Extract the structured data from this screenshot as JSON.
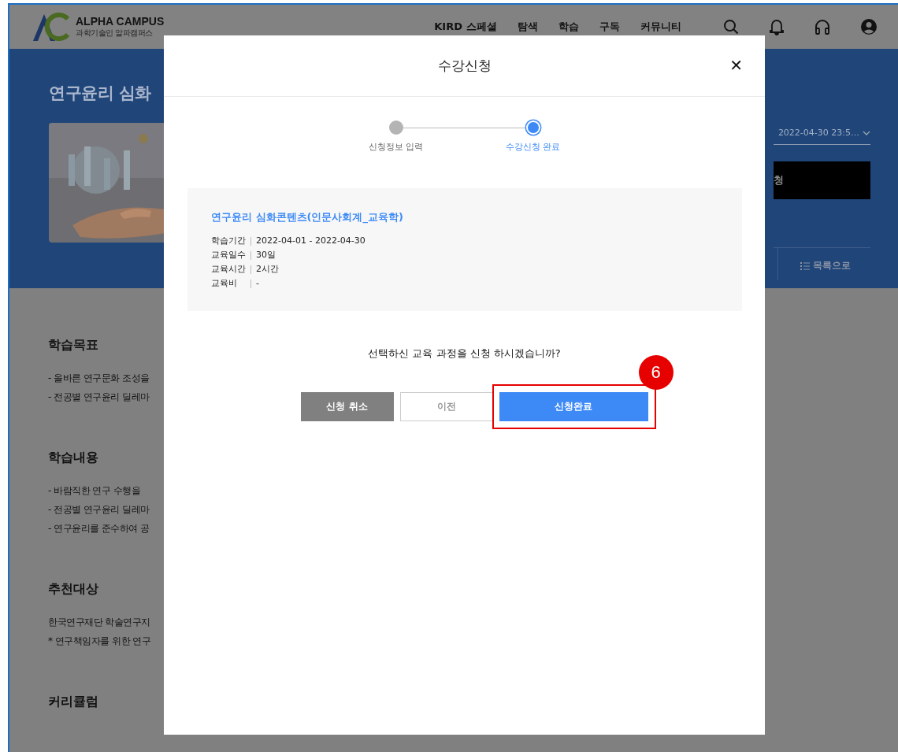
{
  "header": {
    "logo": {
      "name": "ALPHA CAMPUS",
      "subtitle": "과학기술인 알파캠퍼스"
    },
    "nav": [
      "KIRD 스페셜",
      "탐색",
      "학습",
      "구독",
      "커뮤니티"
    ]
  },
  "banner": {
    "title": "연구윤리 심화",
    "period": "2022-04-30 23:5…",
    "apply_button": "청",
    "list_button": "목록으로"
  },
  "sections": [
    {
      "heading": "학습목표",
      "lines": [
        "- 올바른 연구문화 조성을",
        "- 전공별 연구윤리 딜레마"
      ]
    },
    {
      "heading": "학습내용",
      "lines": [
        "- 바람직한 연구 수행을",
        "- 전공별 연구윤리 딜레마",
        "- 연구윤리를 준수하여 공"
      ]
    },
    {
      "heading": "추천대상",
      "lines": [
        "한국연구재단 학술연구지",
        "* 연구책임자를 위한 연구"
      ]
    },
    {
      "heading": "커리큘럼"
    }
  ],
  "modal": {
    "title": "수강신청",
    "close": "✕",
    "steps": [
      {
        "label": "신청정보 입력",
        "selected": false
      },
      {
        "label": "수강신청 완료",
        "selected": true
      }
    ],
    "course": {
      "title": "연구윤리 심화콘텐츠(인문사회계_교육학)",
      "details": [
        {
          "label": "학습기간",
          "value": "2022-04-01 - 2022-04-30"
        },
        {
          "label": "교육일수",
          "value": "30일"
        },
        {
          "label": "교육시간",
          "value": "2시간"
        },
        {
          "label": "교육비",
          "value": "-"
        }
      ]
    },
    "question": "선택하신 교육 과정을 신청 하시겠습니까?",
    "buttons": [
      {
        "label": "신청 취소",
        "kind": "secondary"
      },
      {
        "label": "이전",
        "kind": "outline"
      },
      {
        "label": "신청완료",
        "kind": "primary",
        "highlighted": true
      }
    ],
    "annotation": "6"
  }
}
